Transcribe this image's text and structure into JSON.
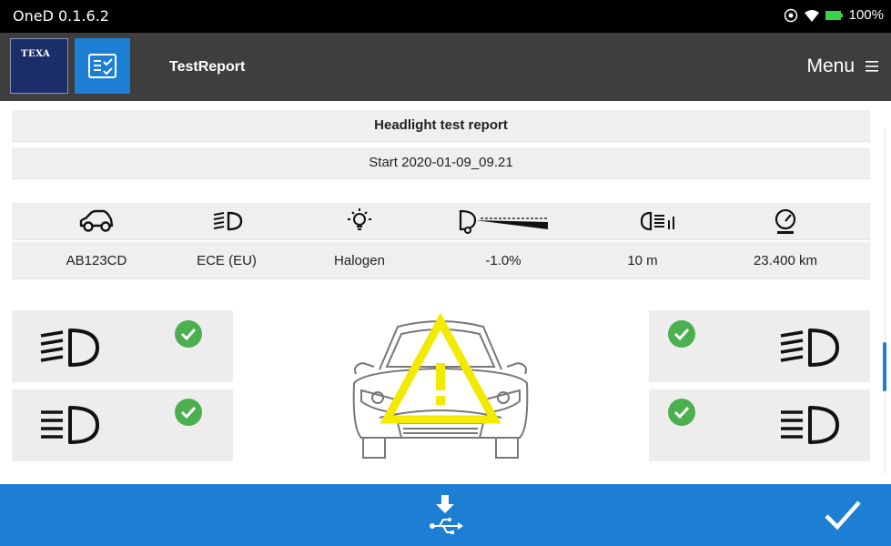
{
  "statusbar": {
    "app_version": "OneD 0.1.6.2",
    "battery": "100%"
  },
  "titlebar": {
    "logo_text": "TEXA",
    "title": "TestReport",
    "menu_label": "Menu"
  },
  "report": {
    "title": "Headlight test report",
    "start": "Start 2020-01-09_09.21",
    "info": [
      {
        "icon": "car-icon",
        "value": "AB123CD"
      },
      {
        "icon": "low-beam-icon",
        "value": "ECE (EU)"
      },
      {
        "icon": "bulb-icon",
        "value": "Halogen"
      },
      {
        "icon": "inclination-icon",
        "value": "-1.0%"
      },
      {
        "icon": "distance-icon",
        "value": "10 m"
      },
      {
        "icon": "odometer-icon",
        "value": "23.400 km"
      }
    ]
  },
  "results": {
    "left_low_beam": "ok",
    "left_high_beam": "ok",
    "right_low_beam": "ok",
    "right_high_beam": "ok",
    "vehicle_status": "warning"
  },
  "colors": {
    "accent": "#1D7FD3",
    "ok": "#4CAF50",
    "warning": "#F2EA00",
    "header": "#3E3E3E"
  }
}
